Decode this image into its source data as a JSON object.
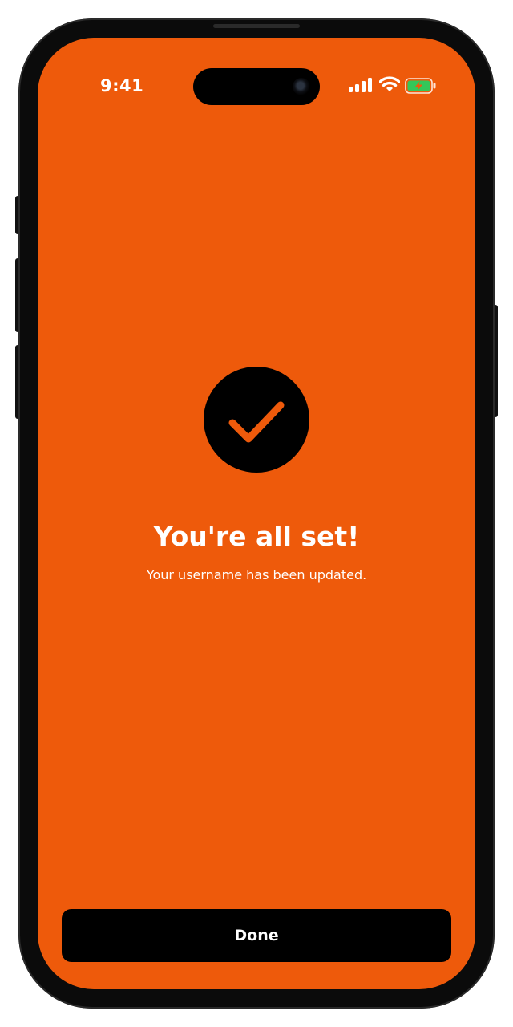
{
  "status_bar": {
    "time": "9:41",
    "icons": [
      "cellular-signal-icon",
      "wifi-icon",
      "battery-charging-icon"
    ],
    "battery_color": "#34c759"
  },
  "confirmation": {
    "icon": "checkmark-circle-icon",
    "title": "You're all set!",
    "message": "Your username has been updated."
  },
  "actions": {
    "done_label": "Done"
  },
  "colors": {
    "background": "#ee5a0b",
    "button": "#000000",
    "text": "#ffffff",
    "checkmark": "#ee5a0b"
  }
}
